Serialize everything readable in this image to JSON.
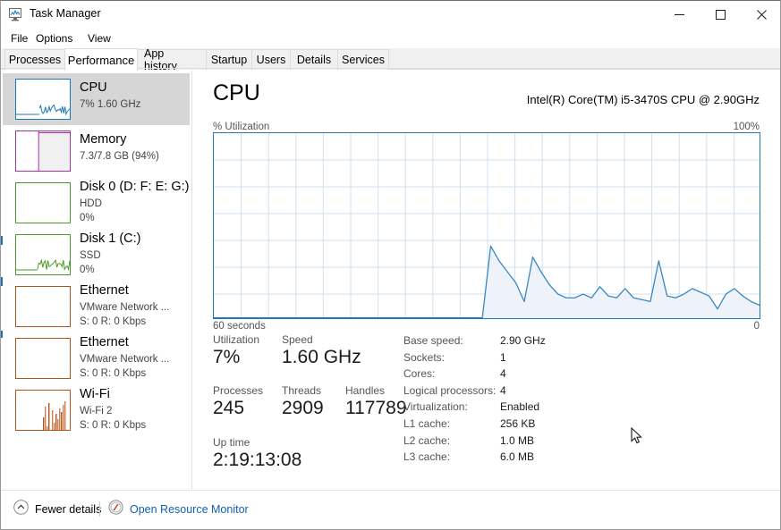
{
  "window": {
    "title": "Task Manager",
    "icon": "task-manager-icon",
    "minimize": "minimize-icon",
    "maximize": "maximize-icon",
    "close": "close-icon"
  },
  "menu": {
    "items": [
      "File",
      "Options",
      "View"
    ]
  },
  "tabs": {
    "items": [
      "Processes",
      "Performance",
      "App history",
      "Startup",
      "Users",
      "Details",
      "Services"
    ],
    "active": "Performance"
  },
  "sidebar": {
    "items": [
      {
        "title": "CPU",
        "line2": "7%  1.60 GHz",
        "line3": "",
        "color": "#1f77b4",
        "selected": true
      },
      {
        "title": "Memory",
        "line2": "7.3/7.8 GB (94%)",
        "line3": "",
        "color": "#a235a2",
        "selected": false
      },
      {
        "title": "Disk 0 (D: F: E: G:)",
        "line2": "HDD",
        "line3": "0%",
        "color": "#4c9a2a",
        "selected": false
      },
      {
        "title": "Disk 1 (C:)",
        "line2": "SSD",
        "line3": "0%",
        "color": "#4c9a2a",
        "selected": false
      },
      {
        "title": "Ethernet",
        "line2": "VMware Network ...",
        "line3": "S: 0 R: 0 Kbps",
        "color": "#b5541a",
        "selected": false
      },
      {
        "title": "Ethernet",
        "line2": "VMware Network ...",
        "line3": "S: 0 R: 0 Kbps",
        "color": "#b5541a",
        "selected": false
      },
      {
        "title": "Wi-Fi",
        "line2": "Wi-Fi 2",
        "line3": "S: 0 R: 0 Kbps",
        "color": "#b5541a",
        "selected": false
      }
    ]
  },
  "detail": {
    "heading": "CPU",
    "model": "Intel(R) Core(TM) i5-3470S CPU @ 2.90GHz",
    "graph_top_label": "% Utilization",
    "graph_max_label": "100%",
    "graph_time_label": "60 seconds",
    "graph_zero_label": "0",
    "stats": [
      {
        "label": "Utilization",
        "value": "7%"
      },
      {
        "label": "Speed",
        "value": "1.60 GHz"
      },
      {
        "label": "Processes",
        "value": "245"
      },
      {
        "label": "Threads",
        "value": "2909"
      },
      {
        "label": "Handles",
        "value": "117789"
      },
      {
        "label": "Up time",
        "value": "2:19:13:08"
      }
    ],
    "specs": [
      {
        "label": "Base speed:",
        "value": "2.90 GHz"
      },
      {
        "label": "Sockets:",
        "value": "1"
      },
      {
        "label": "Cores:",
        "value": "4"
      },
      {
        "label": "Logical processors:",
        "value": "4"
      },
      {
        "label": "Virtualization:",
        "value": "Enabled"
      },
      {
        "label": "L1 cache:",
        "value": "256 KB"
      },
      {
        "label": "L2 cache:",
        "value": "1.0 MB"
      },
      {
        "label": "L3 cache:",
        "value": "6.0 MB"
      }
    ]
  },
  "statusbar": {
    "fewer_details": "Fewer details",
    "fewer_details_icon": "chevron-up-circle-icon",
    "open_resource_monitor": "Open Resource Monitor",
    "open_resource_monitor_icon": "resource-monitor-icon"
  },
  "colors": {
    "accent": "#2277b5",
    "graph_fill": "#edf3f9",
    "grid": "#cfe0ee",
    "link": "#0f5fb5",
    "selection": "#d6d6d6"
  },
  "chart_data": {
    "type": "area",
    "title": "% Utilization",
    "xlabel": "60 seconds",
    "ylabel": "% Utilization",
    "ylim": [
      0,
      100
    ],
    "xlim": [
      -60,
      0
    ],
    "grid": true,
    "legend": "none",
    "note": "CPU utilization history over the last 60 seconds; trace begins mid-window.",
    "x": [
      -30.5,
      -29.5,
      -28.5,
      -27.5,
      -26.5,
      -25.5,
      -24.5,
      -23.5,
      -22.5,
      -21.5,
      -20.5,
      -19.5,
      -18.5,
      -17.5,
      -16.5,
      -15.5,
      -14.5,
      -13.5,
      -12.5,
      -11.5,
      -10.5,
      -9.5,
      -8.5,
      -7.5,
      -6.5,
      -5.5,
      -4.5,
      -3.5,
      -2.5,
      -1.5,
      -0.5,
      0
    ],
    "values": [
      0,
      39,
      31,
      25,
      19,
      9,
      33,
      25,
      18,
      13,
      11,
      11,
      13,
      11,
      17,
      12,
      11,
      16,
      11,
      10,
      9,
      31,
      12,
      11,
      13,
      16,
      14,
      12,
      5,
      13,
      16,
      12,
      9,
      7
    ]
  }
}
